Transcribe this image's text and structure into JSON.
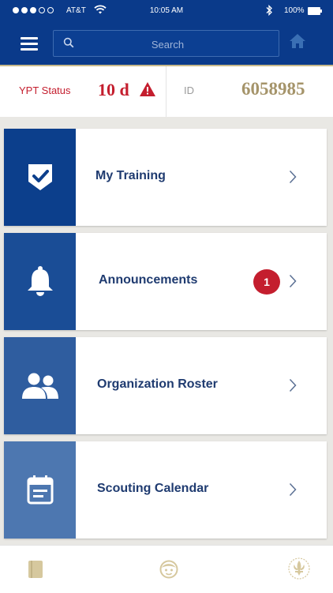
{
  "status_bar": {
    "carrier": "AT&T",
    "time": "10:05 AM",
    "battery": "100%"
  },
  "nav": {
    "search_placeholder": "Search",
    "icons": [
      "menu-icon",
      "search-icon",
      "home-icon"
    ]
  },
  "ypt": {
    "label": "YPT Status",
    "value": "10 d",
    "warning_icon": "warning-icon",
    "id_label": "ID",
    "id_value": "6058985"
  },
  "cards": [
    {
      "label": "My Training",
      "icon": "shield-check-icon",
      "color": "#0c3f8c"
    },
    {
      "label": "Announcements",
      "icon": "bell-icon",
      "color": "#1a4d96",
      "badge": "1"
    },
    {
      "label": "Organization Roster",
      "icon": "people-icon",
      "color": "#2f5d9f"
    },
    {
      "label": "Scouting Calendar",
      "icon": "calendar-icon",
      "color": "#4d77b0"
    }
  ],
  "tab_bar": {
    "icons": [
      "book-icon",
      "face-icon",
      "fleur-de-lis-icon"
    ]
  },
  "colors": {
    "navy": "#0a3a8a",
    "alert_red": "#c41e2e",
    "gold": "#a5946a",
    "card_label": "#1f3b70",
    "tab_icon": "#d6c89e"
  }
}
